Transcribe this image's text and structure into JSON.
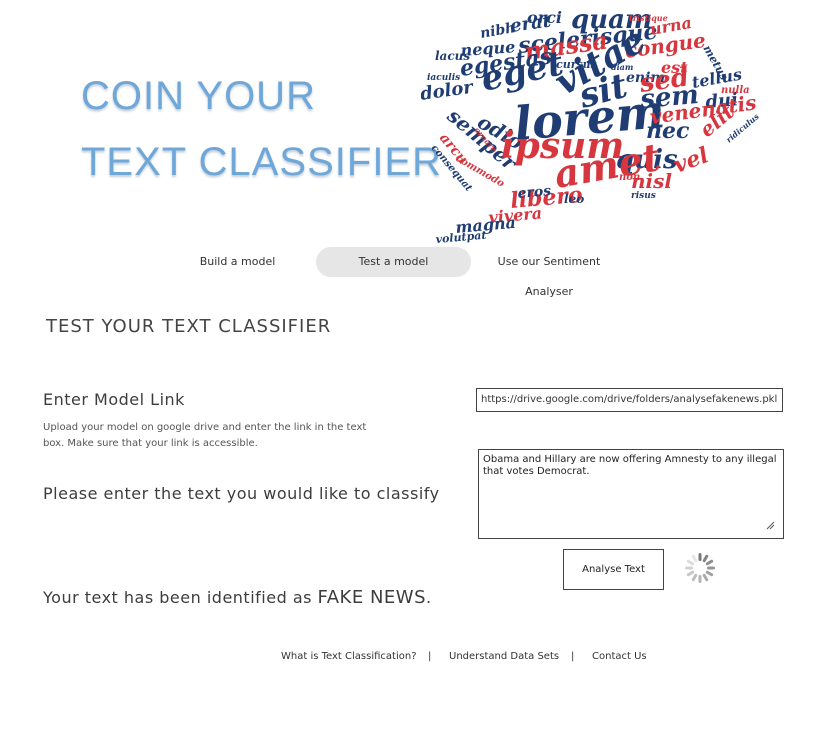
{
  "banner": {
    "title_line1": "COIN YOUR",
    "title_line2": "TEXT CLASSIFIER",
    "word_cloud_words": [
      "orci",
      "quam",
      "tristique",
      "nibh",
      "erat",
      "scelerisque",
      "urna",
      "neque",
      "massa",
      "congue",
      "metus",
      "lacus",
      "egestas",
      "cursus",
      "diam",
      "est",
      "iaculis",
      "eget",
      "vitae",
      "enim",
      "sed",
      "tellus",
      "dolor",
      "sit",
      "sem",
      "dui",
      "nulla",
      "odio",
      "lorem",
      "venenatis",
      "semper",
      "arcu",
      "nec",
      "elit",
      "ridiculus",
      "ornare",
      "consequat",
      "ipsum",
      "quis",
      "vel",
      "commodo",
      "amet",
      "nisl",
      "non",
      "libero",
      "eros",
      "leo",
      "risus",
      "vivera",
      "magna",
      "volutpat"
    ],
    "colors": {
      "red": "#d8363f",
      "navy": "#1f3d73",
      "light_blue": "#6fa8d8"
    }
  },
  "nav": {
    "items": [
      {
        "label": "Build a  model",
        "active": false
      },
      {
        "label": "Test a model",
        "active": true
      },
      {
        "label": "Use our Sentiment Analyser",
        "active": false
      }
    ]
  },
  "main": {
    "section_title": "TEST YOUR TEXT CLASSIFIER",
    "model_link_label": "Enter Model Link",
    "model_link_help": "Upload your model on google drive and enter the link in the text box.  Make sure that your link is accessible.",
    "model_link_value": "https://drive.google.com/drive/folders/analysefakenews.pkl",
    "text_label": "Please enter the text you would like to classify",
    "text_value": "Obama and Hillary are now offering Amnesty to any illegal that votes Democrat.",
    "analyse_button": "Analyse Text",
    "result_prefix": "Your text has been identified as",
    "result_verdict": "FAKE NEWS",
    "result_suffix": "."
  },
  "footer": {
    "links": [
      "What is Text Classification?",
      "Understand Data Sets",
      "Contact Us"
    ],
    "separator": "|"
  }
}
